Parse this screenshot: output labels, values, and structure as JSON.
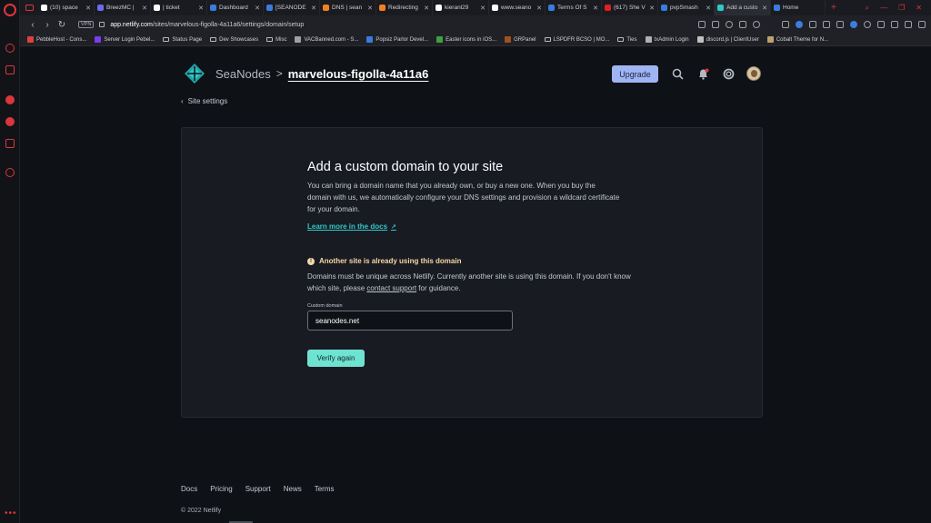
{
  "browser": {
    "tabs": [
      {
        "label": "(10) space",
        "color": "#ffffff"
      },
      {
        "label": "BreezMC |",
        "color": "#6a6cf0"
      },
      {
        "label": "| ticket",
        "color": "#ffffff"
      },
      {
        "label": "Dashboard",
        "color": "#3a7be0"
      },
      {
        "label": "[SEANODE",
        "color": "#3a7be0"
      },
      {
        "label": "DNS | sean",
        "color": "#f38020"
      },
      {
        "label": "Redirecting",
        "color": "#f38020"
      },
      {
        "label": "kieranl29",
        "color": "#ffffff"
      },
      {
        "label": "www.seano",
        "color": "#ffffff"
      },
      {
        "label": "Terms Of S",
        "color": "#3a7be0"
      },
      {
        "label": "(617) She V",
        "color": "#e02020"
      },
      {
        "label": "pvpSmash",
        "color": "#3a7be0"
      },
      {
        "label": "Add a custo",
        "color": "#30c8c9",
        "active": true
      },
      {
        "label": "Home",
        "color": "#3a7be0"
      }
    ],
    "url_host": "app.netlify.com",
    "url_path": "/sites/marvelous-figolla-4a11a6/settings/domain/setup",
    "vpn_label": "VPN",
    "bookmarks": [
      {
        "label": "PebbleHost - Cons...",
        "color": "#e04040"
      },
      {
        "label": "Server Login Pebel...",
        "color": "#7a3cf0"
      },
      {
        "label": "Status Page",
        "folder": true
      },
      {
        "label": "Dev Showcases",
        "folder": true
      },
      {
        "label": "Misc",
        "folder": true
      },
      {
        "label": "VACBanned.com - S...",
        "color": "#a0a0a0"
      },
      {
        "label": "Popsiz Parlor Devel...",
        "color": "#3a7be0"
      },
      {
        "label": "Easter icons in iOS...",
        "color": "#40a040"
      },
      {
        "label": "GRPanel",
        "color": "#a05020"
      },
      {
        "label": "LSPDFR BCSO | MO...",
        "folder": true
      },
      {
        "label": "Ties",
        "folder": true
      },
      {
        "label": "txAdmin Login",
        "color": "#b0b0b0"
      },
      {
        "label": "discord.js | ClientUser",
        "color": "#c0c0c0"
      },
      {
        "label": "Cobalt Theme for N...",
        "color": "#c0a070"
      }
    ]
  },
  "header": {
    "team": "SeaNodes",
    "separator": ">",
    "site": "marvelous-figolla-4a11a6",
    "upgrade_label": "Upgrade"
  },
  "nav": {
    "back_label": "Site settings"
  },
  "card": {
    "title": "Add a custom domain to your site",
    "description": "You can bring a domain name that you already own, or buy a new one. When you buy the domain with us, we automatically configure your DNS settings and provision a wildcard certificate for your domain.",
    "docs_link": "Learn more in the docs",
    "warning_title": "Another site is already using this domain",
    "warning_text_before": "Domains must be unique across Netlify. Currently another site is using this domain. If you don't know which site, please ",
    "warning_link": "contact support",
    "warning_text_after": " for guidance.",
    "field_label": "Custom domain",
    "field_value": "seanodes.net",
    "verify_label": "Verify again"
  },
  "footer": {
    "links": [
      "Docs",
      "Pricing",
      "Support",
      "News",
      "Terms"
    ],
    "copyright": "© 2022 Netlify"
  },
  "colors": {
    "accent_teal": "#30c8c9",
    "button_teal": "#6fe3d2",
    "upgrade_bg": "#9fb4f3",
    "warning": "#f6d8a6",
    "opera_red": "#d9363e"
  }
}
